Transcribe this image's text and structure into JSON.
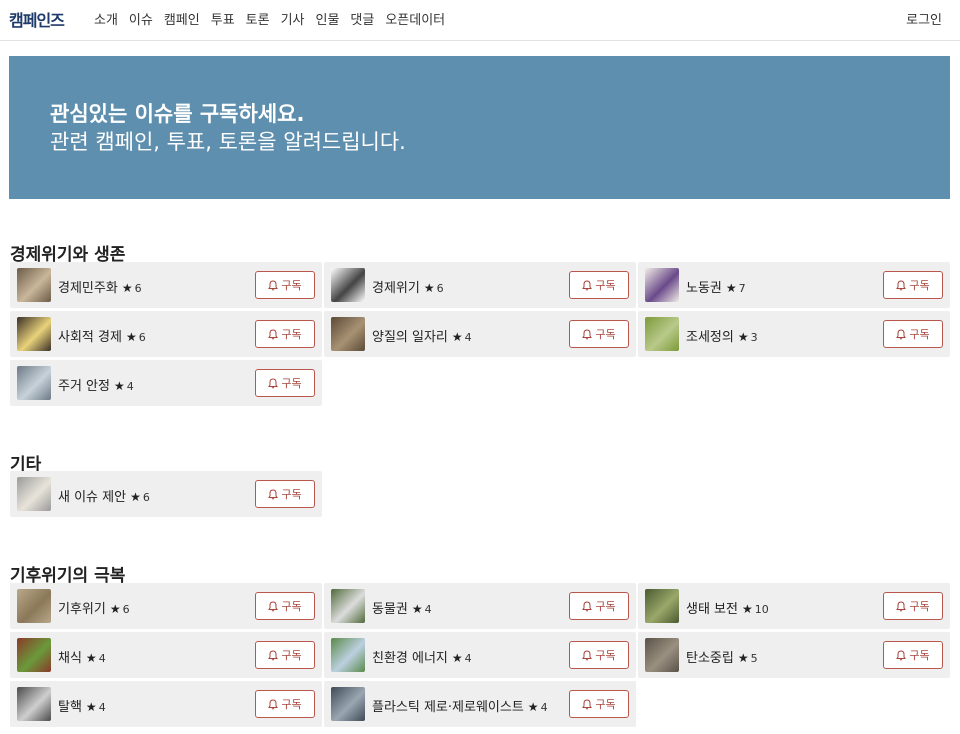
{
  "nav": {
    "logo": "캠페인즈",
    "links": [
      "소개",
      "이슈",
      "캠페인",
      "투표",
      "토론",
      "기사",
      "인물",
      "댓글",
      "오픈데이터"
    ],
    "login": "로그인"
  },
  "hero": {
    "title": "관심있는 이슈를 구독하세요.",
    "subtitle": "관련 캠페인, 투표, 토론을 알려드립니다."
  },
  "subscribe_label": "구독",
  "colors": {
    "hero_bg": "#5f8fae",
    "card_bg": "#efefef",
    "button_border": "#b9574d",
    "logo": "#1e3a6b"
  },
  "sections": [
    {
      "title": "경제위기와 생존",
      "issues": [
        {
          "name": "경제민주화",
          "count": "6",
          "thumb": [
            "#6b5a47",
            "#c9b79a"
          ]
        },
        {
          "name": "경제위기",
          "count": "6",
          "thumb": [
            "#ffffff",
            "#444444"
          ]
        },
        {
          "name": "노동권",
          "count": "7",
          "thumb": [
            "#f2ede6",
            "#6a4a8a"
          ]
        },
        {
          "name": "사회적 경제",
          "count": "6",
          "thumb": [
            "#3a2f28",
            "#e8d27a"
          ]
        },
        {
          "name": "양질의 일자리",
          "count": "4",
          "thumb": [
            "#5b4a36",
            "#a89274"
          ]
        },
        {
          "name": "조세정의",
          "count": "3",
          "thumb": [
            "#7c9a3a",
            "#b9c98a"
          ]
        },
        {
          "name": "주거 안정",
          "count": "4",
          "thumb": [
            "#6c7a86",
            "#c8d2da"
          ]
        }
      ]
    },
    {
      "title": "기타",
      "issues": [
        {
          "name": "새 이슈 제안",
          "count": "6",
          "thumb": [
            "#9a9a9a",
            "#e8e4da"
          ]
        }
      ]
    },
    {
      "title": "기후위기의 극복",
      "issues": [
        {
          "name": "기후위기",
          "count": "6",
          "thumb": [
            "#b8a88a",
            "#8a7858"
          ]
        },
        {
          "name": "동물권",
          "count": "4",
          "thumb": [
            "#4f6a3a",
            "#dcdcdc"
          ]
        },
        {
          "name": "생태 보전",
          "count": "10",
          "thumb": [
            "#4a5a30",
            "#9aa86a"
          ]
        },
        {
          "name": "채식",
          "count": "4",
          "thumb": [
            "#8a3a2a",
            "#6a9a3a"
          ]
        },
        {
          "name": "친환경 에너지",
          "count": "4",
          "thumb": [
            "#5a8a4a",
            "#bcd0e0"
          ]
        },
        {
          "name": "탄소중립",
          "count": "5",
          "thumb": [
            "#5a5248",
            "#9a9080"
          ]
        },
        {
          "name": "탈핵",
          "count": "4",
          "thumb": [
            "#4a4a4a",
            "#cfcfcf"
          ]
        },
        {
          "name": "플라스틱 제로·제로웨이스트",
          "count": "4",
          "thumb": [
            "#3e4a56",
            "#9aa6b0"
          ]
        }
      ]
    }
  ]
}
